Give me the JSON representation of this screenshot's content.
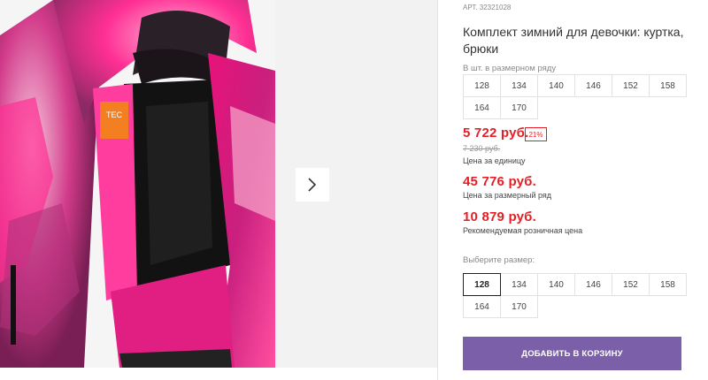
{
  "product": {
    "article": "АРТ. 32321028",
    "title": "Комплект зимний для девочки: куртка, брюки",
    "image_alt": "pink winter jacket photo",
    "brand_tag": "TEC"
  },
  "size_row_block": {
    "label": "В шт. в размерном ряду",
    "sizes": [
      "128",
      "134",
      "140",
      "146",
      "152",
      "158",
      "164",
      "170"
    ]
  },
  "pricing": {
    "unit_price": "5 722 руб.",
    "discount_badge": "21%",
    "old_price": "7 230 руб.",
    "unit_price_caption": "Цена за единицу",
    "row_price": "45 776 руб.",
    "row_price_caption": "Цена за размерный ряд",
    "retail_price": "10 879 руб.",
    "retail_price_caption": "Рекомендуемая розничная цена"
  },
  "size_select": {
    "label": "Выберите размер:",
    "selected": "128",
    "sizes": [
      "128",
      "134",
      "140",
      "146",
      "152",
      "158",
      "164",
      "170"
    ]
  },
  "actions": {
    "add_to_cart": "ДОБАВИТЬ В КОРЗИНУ"
  },
  "colors": {
    "accent_red": "#e51e25",
    "button_purple": "#7b5fa8"
  }
}
